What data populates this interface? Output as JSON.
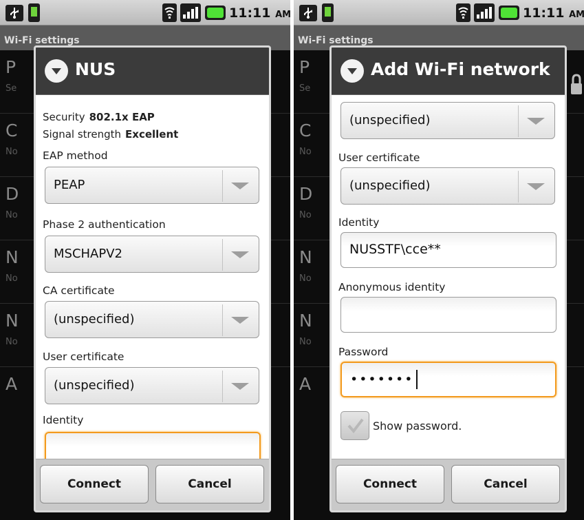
{
  "status_bar": {
    "time": "11:11",
    "ampm": "AM"
  },
  "background": {
    "header": "Wi-Fi settings",
    "items": [
      {
        "title": "P",
        "subtitle": "Se"
      },
      {
        "title": "C",
        "subtitle": "No"
      },
      {
        "title": "D",
        "subtitle": "No"
      },
      {
        "title": "N",
        "subtitle": "No"
      },
      {
        "title": "N",
        "subtitle": "No"
      },
      {
        "title": "A",
        "subtitle": ""
      }
    ]
  },
  "left_dialog": {
    "title": "NUS",
    "security_label": "Security",
    "security_value": "802.1x EAP",
    "signal_label": "Signal strength",
    "signal_value": "Excellent",
    "eap_method_label": "EAP method",
    "eap_method_value": "PEAP",
    "phase2_label": "Phase 2 authentication",
    "phase2_value": "MSCHAPV2",
    "ca_cert_label": "CA certificate",
    "ca_cert_value": "(unspecified)",
    "user_cert_label": "User certificate",
    "user_cert_value": "(unspecified)",
    "identity_label": "Identity",
    "identity_value": "",
    "connect_label": "Connect",
    "cancel_label": "Cancel"
  },
  "right_dialog": {
    "title": "Add Wi-Fi network",
    "ca_cert_value": "(unspecified)",
    "user_cert_label": "User certificate",
    "user_cert_value": "(unspecified)",
    "identity_label": "Identity",
    "identity_value": "NUSSTF\\cce**",
    "anon_identity_label": "Anonymous identity",
    "anon_identity_value": "",
    "password_label": "Password",
    "password_value": "•••••••",
    "show_password_label": "Show password.",
    "show_password_checked": true,
    "connect_label": "Connect",
    "cancel_label": "Cancel"
  }
}
